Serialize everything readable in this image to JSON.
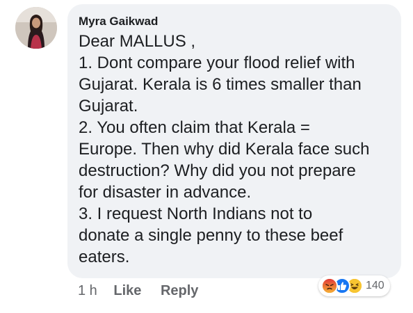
{
  "comment": {
    "author": "Myra Gaikwad",
    "lines": [
      "Dear MALLUS ,",
      "1. Dont compare your flood relief with",
      "Gujarat. Kerala is 6 times smaller than",
      "Gujarat.",
      "2.  You often claim that Kerala =",
      "Europe. Then why did Kerala face such",
      "destruction? Why did you not prepare",
      "for disaster in advance.",
      "3. I request North Indians not to",
      "donate a single penny to these beef",
      "eaters."
    ]
  },
  "actions": {
    "time": "1 h",
    "like_label": "Like",
    "reply_label": "Reply"
  },
  "reactions": {
    "icons": [
      "angry-icon",
      "like-icon",
      "haha-icon"
    ],
    "count": "140"
  },
  "colors": {
    "bubble": "#f0f2f5",
    "text": "#1c1e21",
    "meta": "#65676b",
    "like_blue": "#1877f2",
    "angry_red": "#e9710f",
    "haha_yellow": "#f7b125"
  }
}
